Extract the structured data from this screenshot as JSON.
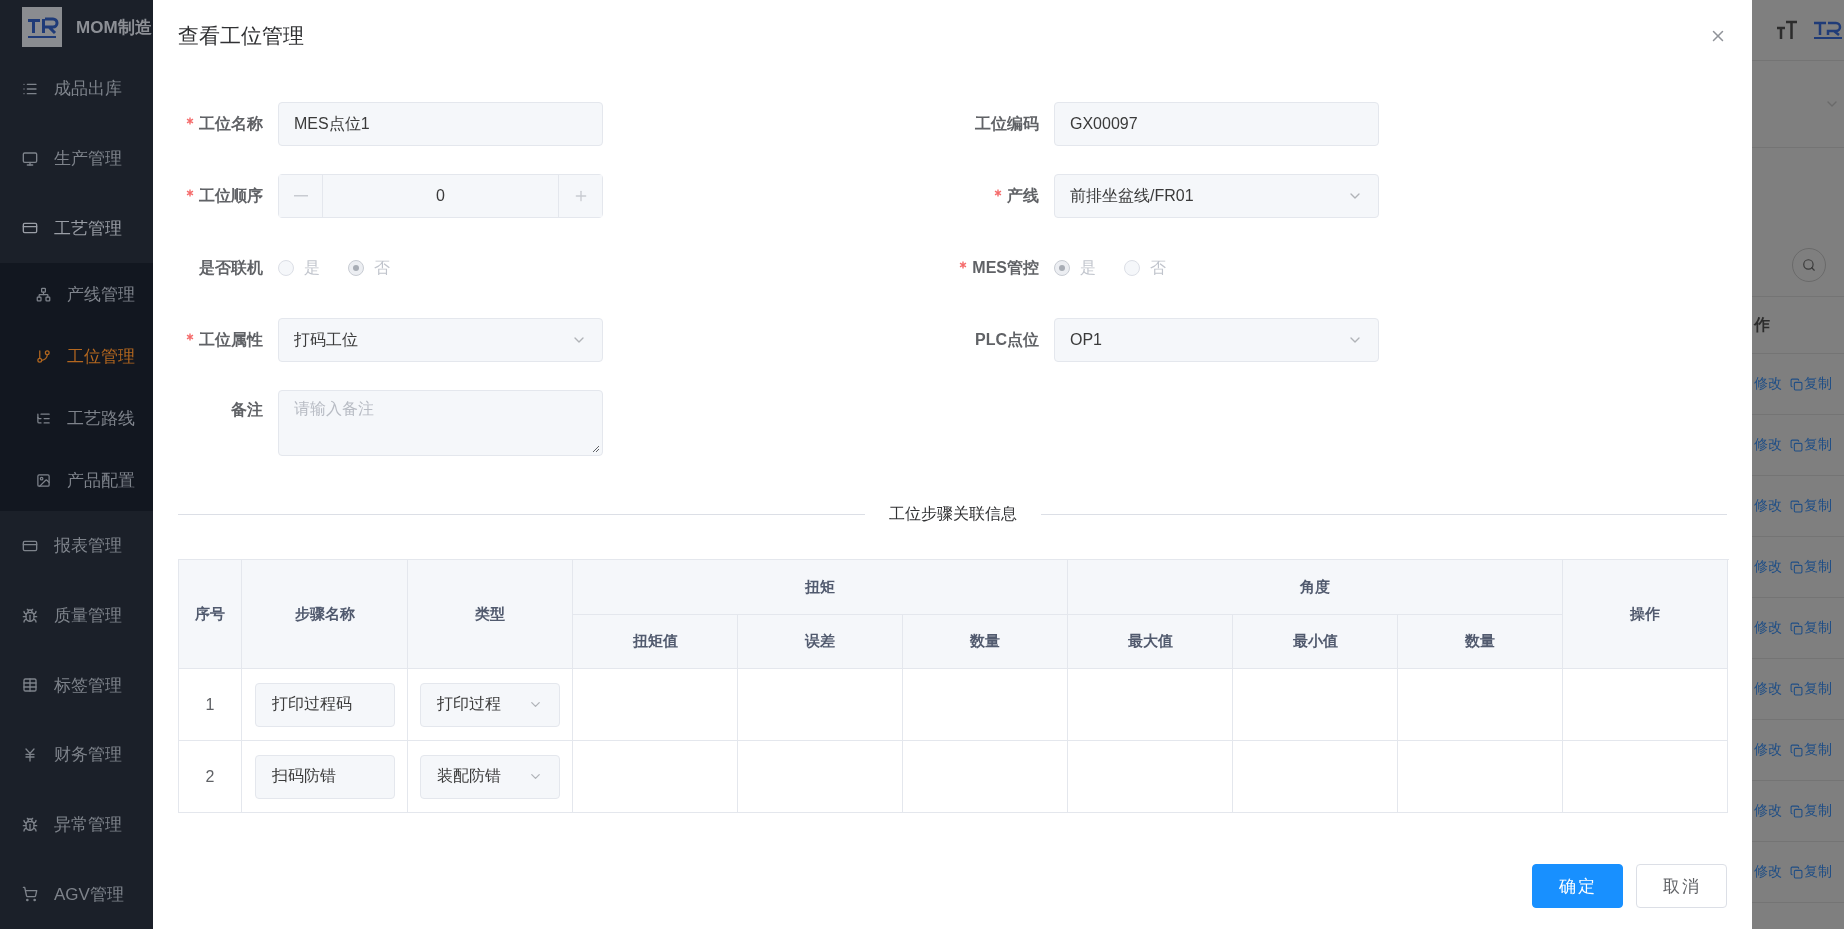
{
  "sidebar": {
    "brand": "MOM制造",
    "items": [
      {
        "label": "成品出库"
      },
      {
        "label": "生产管理"
      },
      {
        "label": "工艺管理",
        "expanded": true,
        "children": [
          {
            "label": "产线管理",
            "selected": false
          },
          {
            "label": "工位管理",
            "selected": true
          },
          {
            "label": "工艺路线",
            "selected": false
          },
          {
            "label": "产品配置",
            "selected": false
          }
        ]
      },
      {
        "label": "报表管理"
      },
      {
        "label": "质量管理"
      },
      {
        "label": "标签管理"
      },
      {
        "label": "财务管理"
      },
      {
        "label": "异常管理"
      },
      {
        "label": "AGV管理"
      }
    ]
  },
  "background": {
    "column_header": "作",
    "rows": [
      {
        "edit": "修改",
        "copy": "复制"
      },
      {
        "edit": "修改",
        "copy": "复制"
      },
      {
        "edit": "修改",
        "copy": "复制"
      },
      {
        "edit": "修改",
        "copy": "复制"
      },
      {
        "edit": "修改",
        "copy": "复制"
      },
      {
        "edit": "修改",
        "copy": "复制"
      },
      {
        "edit": "修改",
        "copy": "复制"
      },
      {
        "edit": "修改",
        "copy": "复制"
      },
      {
        "edit": "修改",
        "copy": "复制"
      }
    ]
  },
  "dialog": {
    "title": "查看工位管理",
    "fields": [
      {
        "kind": "text",
        "label": "工位名称",
        "required": true,
        "value": "MES点位1"
      },
      {
        "kind": "text",
        "label": "工位编码",
        "required": false,
        "value": "GX00097"
      },
      {
        "kind": "number",
        "label": "工位顺序",
        "required": true,
        "value": "0"
      },
      {
        "kind": "select",
        "label": "产线",
        "required": true,
        "value": "前排坐盆线/FR01"
      },
      {
        "kind": "radio",
        "label": "是否联机",
        "required": false,
        "disabled": true,
        "options": [
          {
            "label": "是",
            "selected": false
          },
          {
            "label": "否",
            "selected": true
          }
        ]
      },
      {
        "kind": "radio",
        "label": "MES管控",
        "required": true,
        "disabled": true,
        "options": [
          {
            "label": "是",
            "selected": true
          },
          {
            "label": "否",
            "selected": false
          }
        ]
      },
      {
        "kind": "select",
        "label": "工位属性",
        "required": true,
        "value": "打码工位"
      },
      {
        "kind": "select",
        "label": "PLC点位",
        "required": false,
        "value": "OP1"
      },
      {
        "kind": "textarea",
        "label": "备注",
        "required": false,
        "placeholder": "请输入备注"
      }
    ],
    "section_title": "工位步骤关联信息",
    "table": {
      "columns": [
        {
          "label": "序号"
        },
        {
          "label": "步骤名称"
        },
        {
          "label": "类型"
        },
        {
          "label": "扭矩",
          "children": [
            "扭矩值",
            "误差",
            "数量"
          ]
        },
        {
          "label": "角度",
          "children": [
            "最大值",
            "最小值",
            "数量"
          ]
        },
        {
          "label": "操作"
        }
      ],
      "rows": [
        {
          "index": "1",
          "step_name": "打印过程码",
          "type": "打印过程"
        },
        {
          "index": "2",
          "step_name": "扫码防错",
          "type": "装配防错"
        }
      ]
    },
    "buttons": [
      {
        "label": "确定",
        "kind": "primary"
      },
      {
        "label": "取消",
        "kind": "default"
      }
    ]
  }
}
